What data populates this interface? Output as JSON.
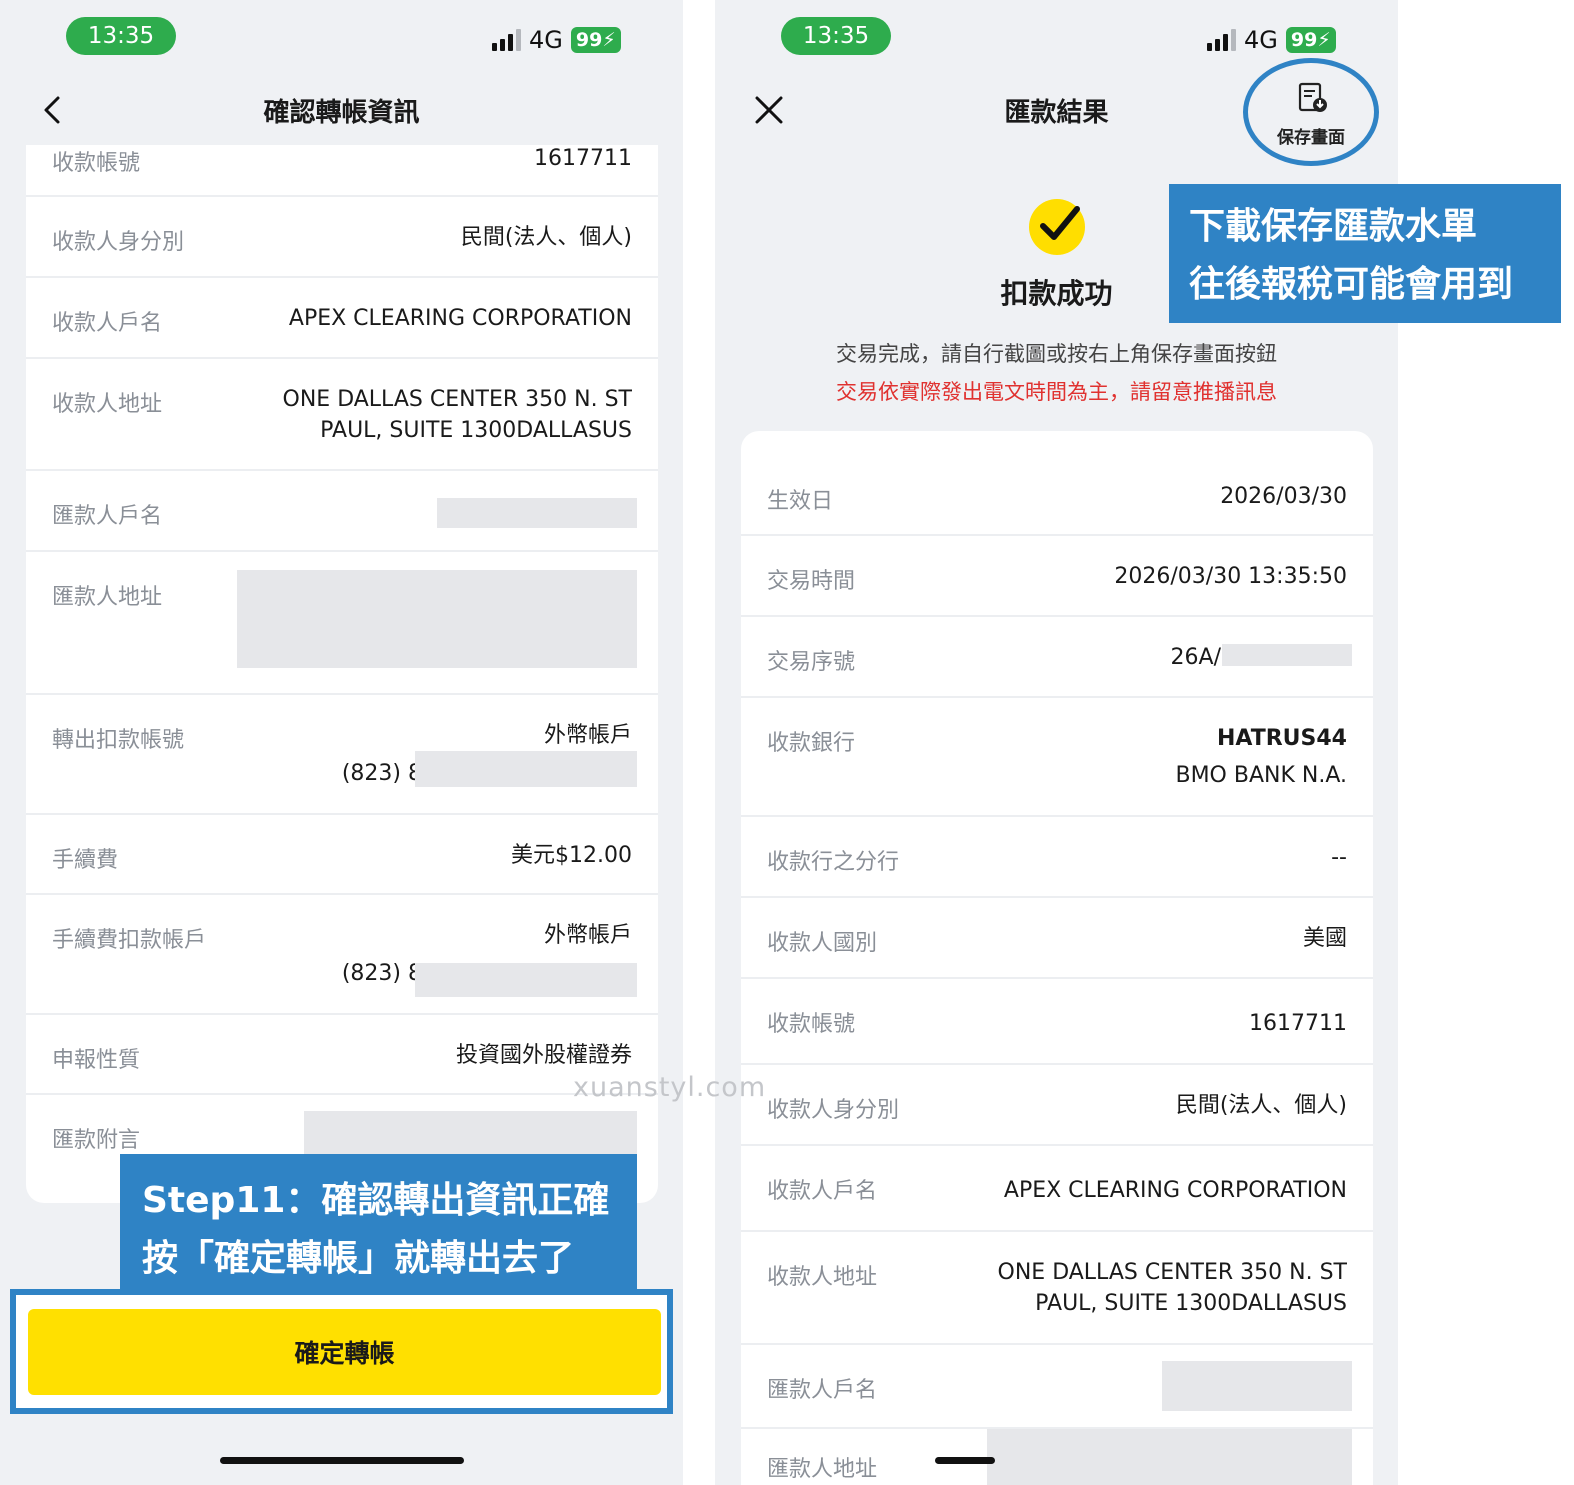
{
  "left": {
    "time": "13:35",
    "network": "4G",
    "battery": "99",
    "title": "確認轉帳資訊",
    "rows": {
      "account": {
        "label": "收款帳號",
        "value": "1617711"
      },
      "identity": {
        "label": "收款人身分別",
        "value": "民間(法人、個人)"
      },
      "payee_name": {
        "label": "收款人戶名",
        "value": "APEX CLEARING CORPORATION"
      },
      "payee_address": {
        "label": "收款人地址",
        "line1": "ONE DALLAS CENTER 350 N. ST",
        "line2": "PAUL, SUITE 1300DALLASUS"
      },
      "remitter_name": {
        "label": "匯款人戶名"
      },
      "remitter_address": {
        "label": "匯款人地址"
      },
      "debit_account": {
        "label": "轉出扣款帳號",
        "type": "外幣帳戶",
        "number_prefix": "(823) 8"
      },
      "fee": {
        "label": "手續費",
        "value": "美元$12.00"
      },
      "fee_account": {
        "label": "手續費扣款帳戶",
        "type": "外幣帳戶",
        "number_prefix": "(823) 8"
      },
      "declaration": {
        "label": "申報性質",
        "value": "投資國外股權證券"
      },
      "memo": {
        "label": "匯款附言"
      }
    },
    "step_note": {
      "line1": "Step11：確認轉出資訊正確",
      "line2": "按「確定轉帳」就轉出去了"
    },
    "confirm_label": "確定轉帳"
  },
  "right": {
    "time": "13:35",
    "network": "4G",
    "battery": "99",
    "title": "匯款結果",
    "save_label": "保存畫面",
    "callout": {
      "line1": "下載保存匯款水單",
      "line2": "往後報稅可能會用到"
    },
    "success_title": "扣款成功",
    "note_main": "交易完成，請自行截圖或按右上角保存畫面按鈕",
    "note_red": "交易依實際發出電文時間為主，請留意推播訊息",
    "rows": {
      "effective_date": {
        "label": "生效日",
        "value": "2026/03/30"
      },
      "txn_time": {
        "label": "交易時間",
        "value": "2026/03/30 13:35:50"
      },
      "txn_no": {
        "label": "交易序號",
        "value_prefix": "26A/"
      },
      "bank": {
        "label": "收款銀行",
        "swift": "HATRUS44",
        "name": "BMO BANK N.A."
      },
      "branch": {
        "label": "收款行之分行",
        "value": "--"
      },
      "country": {
        "label": "收款人國別",
        "value": "美國"
      },
      "account": {
        "label": "收款帳號",
        "value": "1617711"
      },
      "identity": {
        "label": "收款人身分別",
        "value": "民間(法人、個人)"
      },
      "payee_name": {
        "label": "收款人戶名",
        "value": "APEX CLEARING CORPORATION"
      },
      "payee_address": {
        "label": "收款人地址",
        "line1": "ONE DALLAS CENTER 350 N. ST",
        "line2": "PAUL, SUITE 1300DALLASUS"
      },
      "remitter_name": {
        "label": "匯款人戶名"
      },
      "remitter_address": {
        "label": "匯款人地址"
      }
    }
  },
  "watermark": "xuanstyl.com",
  "colors": {
    "accent_blue": "#2f83c5",
    "button_yellow": "#ffe000",
    "status_green": "#2eac4d",
    "warning_red": "#e0312f"
  }
}
